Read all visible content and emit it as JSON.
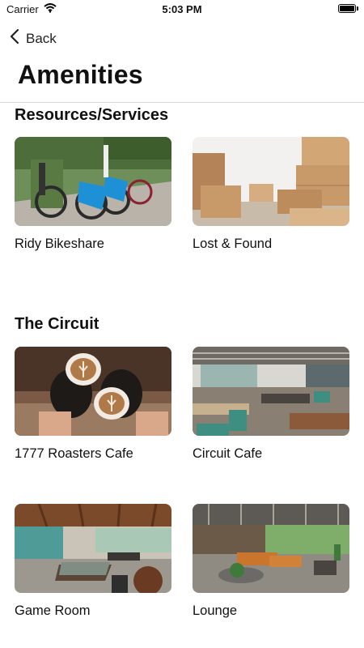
{
  "status": {
    "carrier": "Carrier",
    "time": "5:03 PM"
  },
  "nav": {
    "back_label": "Back",
    "title": "Amenities"
  },
  "sections": [
    {
      "title": "Resources/Services",
      "items": [
        {
          "label": "Ridy Bikeshare"
        },
        {
          "label": "Lost & Found"
        }
      ]
    },
    {
      "title": "The Circuit",
      "items": [
        {
          "label": "1777 Roasters Cafe"
        },
        {
          "label": "Circuit Cafe"
        },
        {
          "label": "Game Room"
        },
        {
          "label": "Lounge"
        }
      ]
    }
  ],
  "colors": {
    "bike_blue": "#1e90d6",
    "box_brown": "#c89a6a",
    "coffee_brown": "#6b4a34",
    "cafe_green": "#3e8f82"
  }
}
